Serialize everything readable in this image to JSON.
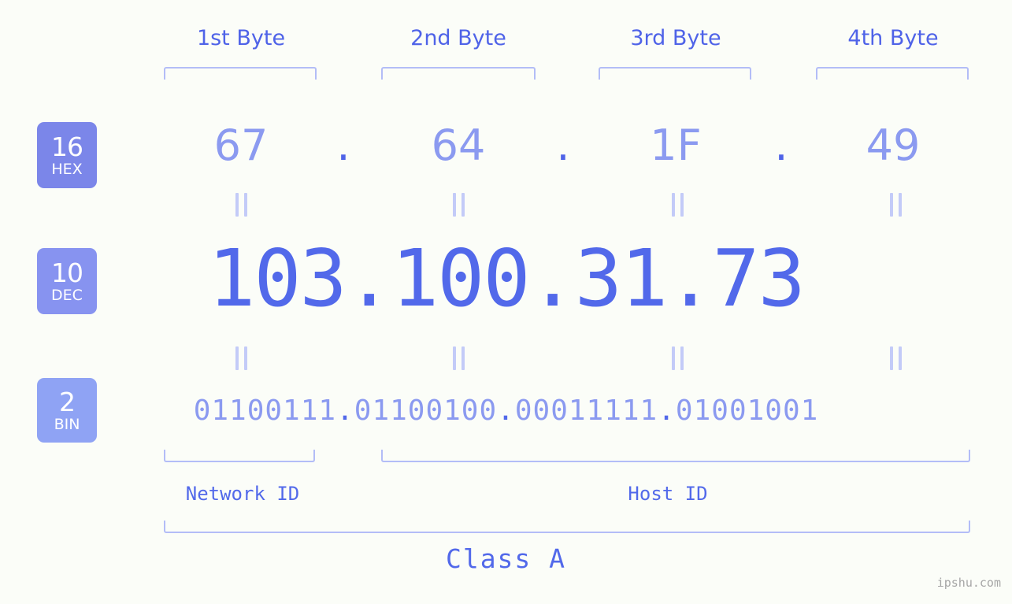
{
  "watermark": "ipshu.com",
  "colors": {
    "background": "#fbfdf8",
    "accent_dark": "#4f63e8",
    "accent_mid": "#5269ea",
    "accent_light": "#8b9af0",
    "bracket": "#b3bdf7",
    "badge_hex": "#7b86e9",
    "badge_dec": "#8793f0",
    "badge_bin": "#8fa3f4",
    "watermark": "#a6a6a6"
  },
  "byte_headers": [
    {
      "label": "1st Byte"
    },
    {
      "label": "2nd Byte"
    },
    {
      "label": "3rd Byte"
    },
    {
      "label": "4th Byte"
    }
  ],
  "bases": [
    {
      "number": "16",
      "abbr": "HEX"
    },
    {
      "number": "10",
      "abbr": "DEC"
    },
    {
      "number": "2",
      "abbr": "BIN"
    }
  ],
  "separator": ".",
  "equals_symbol": "=",
  "rows": {
    "hex": {
      "base_number": "16",
      "base_abbr": "HEX",
      "values": [
        "67",
        "64",
        "1F",
        "49"
      ],
      "full": "67.64.1F.49"
    },
    "dec": {
      "base_number": "10",
      "base_abbr": "DEC",
      "values": [
        "103",
        "100",
        "31",
        "73"
      ],
      "full": "103.100.31.73"
    },
    "bin": {
      "base_number": "2",
      "base_abbr": "BIN",
      "values": [
        "01100111",
        "01100100",
        "00011111",
        "01001001"
      ],
      "full": "01100111.01100100.00011111.01001001"
    }
  },
  "regions": {
    "network_id": "Network ID",
    "host_id": "Host ID",
    "class": "Class A"
  },
  "dec_line": {
    "seg1": "103",
    "sep1": ".",
    "seg2": "100",
    "sep2": ".",
    "seg3": "31",
    "sep3": ".",
    "seg4": "73"
  },
  "bin_line": {
    "seg1": "01100111",
    "sep1": ".",
    "seg2": "01100100",
    "sep2": ".",
    "seg3": "00011111",
    "sep3": ".",
    "seg4": "01001001"
  }
}
